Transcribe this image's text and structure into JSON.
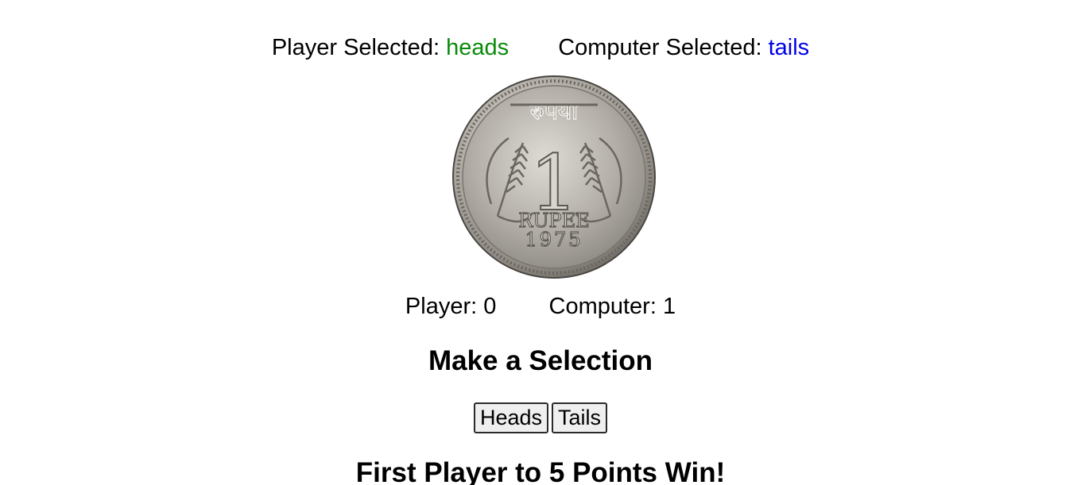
{
  "selections": {
    "player_label": "Player Selected:",
    "player_value": "heads",
    "computer_label": "Computer Selected:",
    "computer_value": "tails"
  },
  "coin": {
    "script_text": "रुपया",
    "numeral": "1",
    "denomination": "RUPEE",
    "year": "1975"
  },
  "scores": {
    "player_label": "Player:",
    "player_score": "0",
    "computer_label": "Computer:",
    "computer_score": "1"
  },
  "heading": "Make a Selection",
  "buttons": {
    "heads_label": "Heads",
    "tails_label": "Tails"
  },
  "footer": "First Player to 5 Points Win!",
  "colors": {
    "player_choice": "#0a8a0a",
    "computer_choice": "#0000e6"
  }
}
